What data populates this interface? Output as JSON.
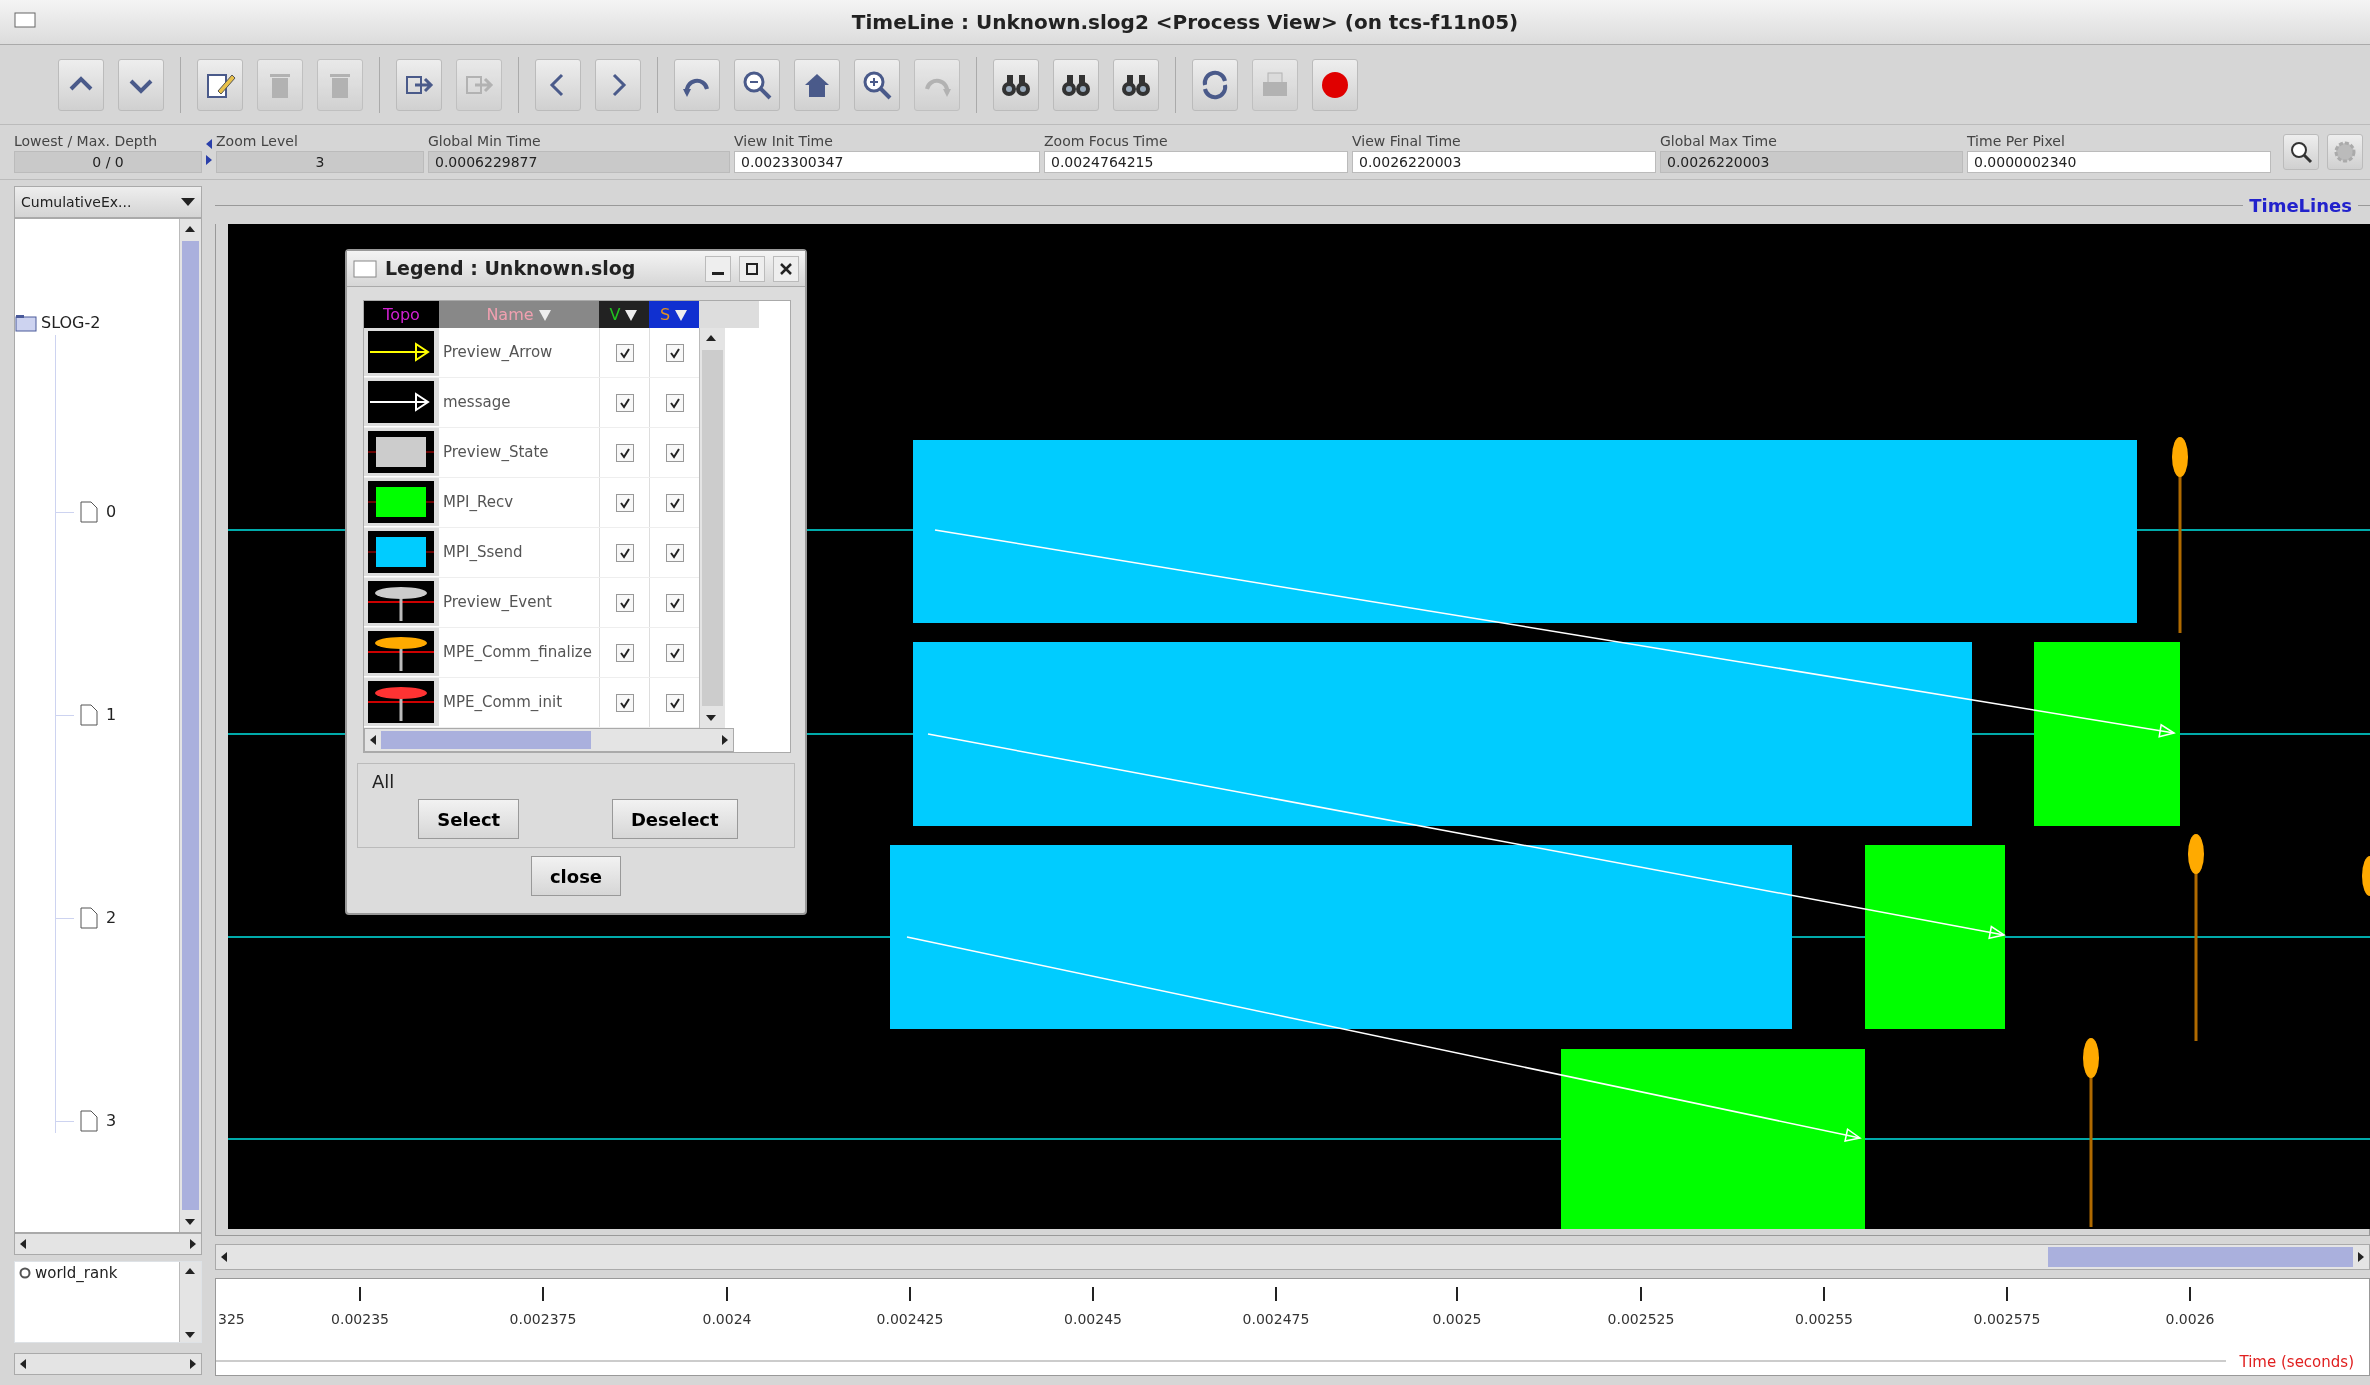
{
  "window": {
    "title": "TimeLine : Unknown.slog2  <Process View> (on tcs-f11n05)"
  },
  "toolbar": [
    {
      "buttons": [
        {
          "kind": "up",
          "disabled": false
        },
        {
          "kind": "down",
          "disabled": false
        }
      ]
    },
    {
      "buttons": [
        {
          "kind": "edit",
          "disabled": false
        },
        {
          "kind": "delete",
          "disabled": true
        },
        {
          "kind": "delete",
          "disabled": true
        }
      ]
    },
    {
      "buttons": [
        {
          "kind": "export",
          "disabled": false
        },
        {
          "kind": "export",
          "disabled": true
        }
      ]
    },
    {
      "buttons": [
        {
          "kind": "back",
          "disabled": false
        },
        {
          "kind": "forward",
          "disabled": false
        }
      ]
    },
    {
      "buttons": [
        {
          "kind": "undo",
          "disabled": false
        },
        {
          "kind": "zoom-out",
          "disabled": false
        },
        {
          "kind": "home",
          "disabled": false
        },
        {
          "kind": "zoom-in",
          "disabled": false
        },
        {
          "kind": "redo",
          "disabled": true
        }
      ]
    },
    {
      "buttons": [
        {
          "kind": "find-back",
          "disabled": false
        },
        {
          "kind": "find",
          "disabled": false
        },
        {
          "kind": "find-forward",
          "disabled": false
        }
      ]
    },
    {
      "buttons": [
        {
          "kind": "refresh",
          "disabled": false
        },
        {
          "kind": "print",
          "disabled": true
        },
        {
          "kind": "stop",
          "disabled": false
        }
      ]
    }
  ],
  "depth": {
    "label": "Lowest / Max. Depth",
    "value": "0 / 0"
  },
  "info_fields": [
    {
      "label": "Zoom Level",
      "value": "3",
      "editable": false
    },
    {
      "label": "Global Min Time",
      "value": "0.0006229877",
      "editable": false
    },
    {
      "label": "View  Init Time",
      "value": "0.0023300347",
      "editable": true
    },
    {
      "label": "Zoom Focus Time",
      "value": "0.0024764215",
      "editable": true
    },
    {
      "label": "View Final Time",
      "value": "0.0026220003",
      "editable": true
    },
    {
      "label": "Global Max Time",
      "value": "0.0026220003",
      "editable": false
    },
    {
      "label": "Time Per Pixel",
      "value": "0.0000002340",
      "editable": true
    }
  ],
  "view_select": {
    "value": "CumulativeEx..."
  },
  "tree": {
    "label": "SLOG-2",
    "children": [
      {
        "label": "0"
      },
      {
        "label": "1"
      },
      {
        "label": "2"
      },
      {
        "label": "3"
      }
    ]
  },
  "group_list": [
    "world_rank"
  ],
  "timelines_title": "TimeLines",
  "axis": {
    "title": "Time (seconds)",
    "ticks": [
      "325",
      "0.00235",
      "0.002375",
      "0.0024",
      "0.002425",
      "0.00245",
      "0.002475",
      "0.0025",
      "0.002525",
      "0.00255",
      "0.002575",
      "0.0026"
    ]
  },
  "legend": {
    "title": "Legend : Unknown.slog",
    "columns": [
      "Topo",
      "Name",
      "V",
      "S"
    ],
    "rows": [
      {
        "name": "Preview_Arrow",
        "kind": "arrow",
        "color": "#ffff00",
        "visible": true,
        "searchable": true
      },
      {
        "name": "message",
        "kind": "arrow",
        "color": "#ffffff",
        "visible": true,
        "searchable": true
      },
      {
        "name": "Preview_State",
        "kind": "state",
        "color": "#cccccc",
        "visible": true,
        "searchable": true
      },
      {
        "name": "MPI_Recv",
        "kind": "state",
        "color": "#00ff00",
        "visible": true,
        "searchable": true
      },
      {
        "name": "MPI_Ssend",
        "kind": "state",
        "color": "#00ccff",
        "visible": true,
        "searchable": true
      },
      {
        "name": "Preview_Event",
        "kind": "event",
        "color": "#cccccc",
        "visible": true,
        "searchable": true
      },
      {
        "name": "MPE_Comm_finalize",
        "kind": "event",
        "color": "#ffaa00",
        "visible": true,
        "searchable": true
      },
      {
        "name": "MPE_Comm_init",
        "kind": "event",
        "color": "#ff3333",
        "visible": true,
        "searchable": true
      }
    ],
    "group_title": "All",
    "buttons": [
      "Select",
      "Deselect"
    ],
    "close": "close"
  }
}
